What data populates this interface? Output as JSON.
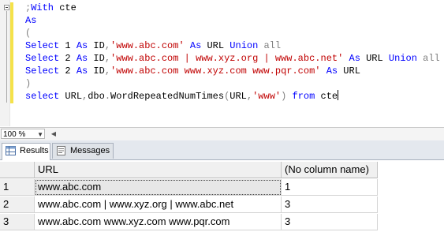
{
  "editor": {
    "lines": [
      [
        {
          "c": "g",
          "t": ";"
        },
        {
          "c": "k",
          "t": "With"
        },
        {
          "c": "t",
          "t": " cte"
        }
      ],
      [
        {
          "c": "k",
          "t": "As"
        }
      ],
      [
        {
          "c": "g",
          "t": "("
        }
      ],
      [
        {
          "c": "k",
          "t": "Select"
        },
        {
          "c": "t",
          "t": " 1 "
        },
        {
          "c": "k",
          "t": "As"
        },
        {
          "c": "t",
          "t": " ID"
        },
        {
          "c": "g",
          "t": ","
        },
        {
          "c": "s",
          "t": "'www.abc.com'"
        },
        {
          "c": "t",
          "t": " "
        },
        {
          "c": "k",
          "t": "As"
        },
        {
          "c": "t",
          "t": " URL "
        },
        {
          "c": "k",
          "t": "Union"
        },
        {
          "c": "t",
          "t": " "
        },
        {
          "c": "g",
          "t": "all"
        }
      ],
      [
        {
          "c": "k",
          "t": "Select"
        },
        {
          "c": "t",
          "t": " 2 "
        },
        {
          "c": "k",
          "t": "As"
        },
        {
          "c": "t",
          "t": " ID"
        },
        {
          "c": "g",
          "t": ","
        },
        {
          "c": "s",
          "t": "'www.abc.com | www.xyz.org | www.abc.net'"
        },
        {
          "c": "t",
          "t": " "
        },
        {
          "c": "k",
          "t": "As"
        },
        {
          "c": "t",
          "t": " URL "
        },
        {
          "c": "k",
          "t": "Union"
        },
        {
          "c": "t",
          "t": " "
        },
        {
          "c": "g",
          "t": "all"
        }
      ],
      [
        {
          "c": "k",
          "t": "Select"
        },
        {
          "c": "t",
          "t": " 2 "
        },
        {
          "c": "k",
          "t": "As"
        },
        {
          "c": "t",
          "t": " ID"
        },
        {
          "c": "g",
          "t": ","
        },
        {
          "c": "s",
          "t": "'www.abc.com www.xyz.com www.pqr.com'"
        },
        {
          "c": "t",
          "t": " "
        },
        {
          "c": "k",
          "t": "As"
        },
        {
          "c": "t",
          "t": " URL"
        }
      ],
      [
        {
          "c": "g",
          "t": ")"
        }
      ],
      [
        {
          "c": "k",
          "t": "select"
        },
        {
          "c": "t",
          "t": " URL"
        },
        {
          "c": "g",
          "t": ","
        },
        {
          "c": "t",
          "t": "dbo"
        },
        {
          "c": "g",
          "t": "."
        },
        {
          "c": "t",
          "t": "WordRepeatedNumTimes"
        },
        {
          "c": "g",
          "t": "("
        },
        {
          "c": "t",
          "t": "URL"
        },
        {
          "c": "g",
          "t": ","
        },
        {
          "c": "s",
          "t": "'www'"
        },
        {
          "c": "g",
          "t": ")"
        },
        {
          "c": "t",
          "t": " "
        },
        {
          "c": "k",
          "t": "from"
        },
        {
          "c": "t",
          "t": " cte"
        }
      ]
    ]
  },
  "zoom": {
    "value": "100 %"
  },
  "tabs": [
    {
      "label": "Results",
      "icon": "grid-results-icon"
    },
    {
      "label": "Messages",
      "icon": "messages-icon"
    }
  ],
  "results": {
    "columns": [
      "",
      "URL",
      "(No column name)"
    ],
    "rows": [
      [
        "1",
        "www.abc.com",
        "1"
      ],
      [
        "2",
        "www.abc.com | www.xyz.org | www.abc.net",
        "3"
      ],
      [
        "3",
        "www.abc.com www.xyz.com www.pqr.com",
        "3"
      ]
    ]
  },
  "colors": {
    "keyword": "#0000ff",
    "string": "#c00000",
    "operator": "#808080",
    "change_bar": "#f5e24a"
  }
}
